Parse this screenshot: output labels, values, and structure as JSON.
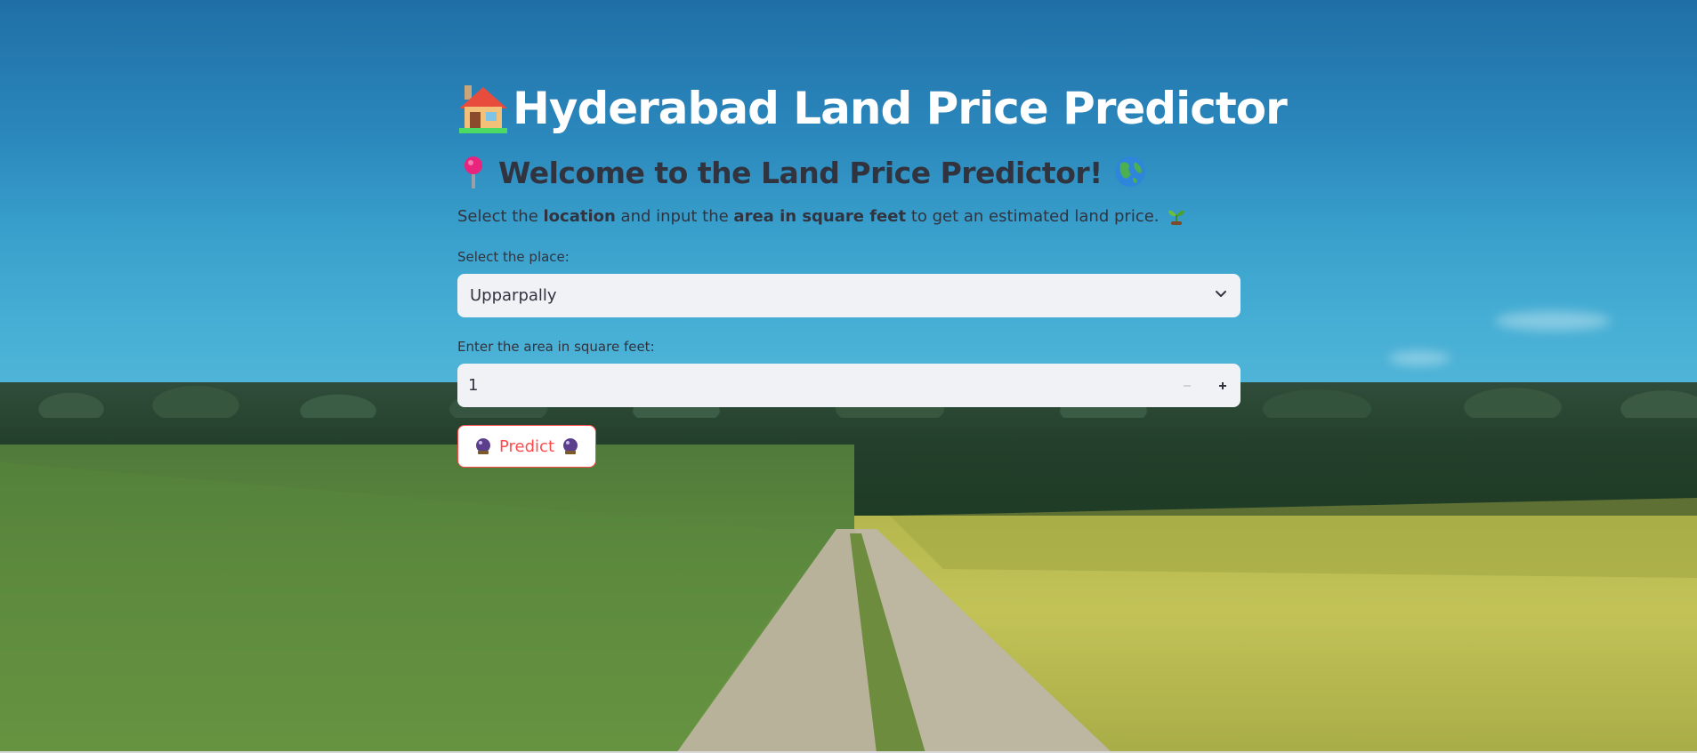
{
  "header": {
    "title": "Hyderabad Land Price Predictor",
    "title_icon": "house-icon"
  },
  "welcome": {
    "text": "Welcome to the Land Price Predictor!",
    "leading_icon": "round-pushpin-icon",
    "trailing_icon": "globe-icon"
  },
  "intro": {
    "part1": "Select the ",
    "bold1": "location",
    "part2": " and input the ",
    "bold2": "area in square feet",
    "part3": " to get an estimated land price.",
    "trailing_icon": "seedling-icon"
  },
  "place_select": {
    "label": "Select the place:",
    "value": "Upparpally",
    "icon": "chevron-down-icon"
  },
  "area_input": {
    "label": "Enter the area in square feet:",
    "value": "1",
    "decrement_icon": "minus-icon",
    "increment_icon": "plus-icon"
  },
  "predict_button": {
    "label": "Predict",
    "icon": "crystal-ball-icon"
  },
  "colors": {
    "accent": "#ff4b4b",
    "text": "#31333f",
    "input_bg": "#f0f2f6",
    "title": "#ffffff"
  }
}
